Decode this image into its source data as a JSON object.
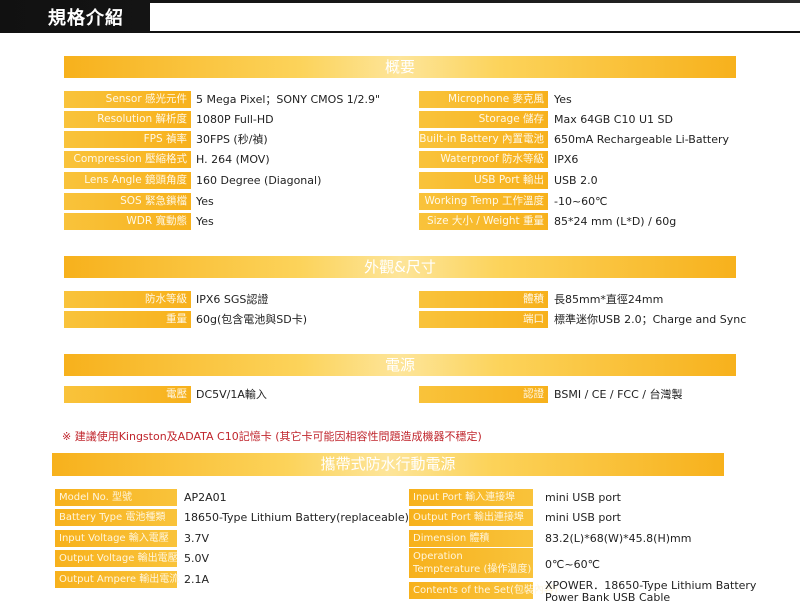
{
  "header": {
    "title": "規格介紹"
  },
  "sections": {
    "overview": "概要",
    "appearance": "外觀&尺寸",
    "power": "電源",
    "powerbank": "攜帶式防水行動電源"
  },
  "overview_left": [
    {
      "label": "Sensor 感光元件",
      "value": "5 Mega Pixel；SONY CMOS 1/2.9\""
    },
    {
      "label": "Resolution 解析度",
      "value": "1080P Full-HD"
    },
    {
      "label": "FPS  禎率",
      "value": "30FPS (秒/禎)"
    },
    {
      "label": "Compression  壓縮格式",
      "value": "H. 264 (MOV)"
    },
    {
      "label": "Lens Angle 鏡頭角度",
      "value": "160 Degree (Diagonal)"
    },
    {
      "label": "SOS 緊急鎖檔",
      "value": "Yes"
    },
    {
      "label": "WDR 寬動態",
      "value": "Yes"
    }
  ],
  "overview_right": [
    {
      "label": "Microphone 麥克風",
      "value": "Yes"
    },
    {
      "label": "Storage 儲存",
      "value": "Max 64GB C10 U1 SD"
    },
    {
      "label": "Built-in Battery 內置電池",
      "value": "650mA Rechargeable Li-Battery"
    },
    {
      "label": "Waterproof 防水等級",
      "value": "IPX6"
    },
    {
      "label": "USB Port 輸出",
      "value": "USB 2.0"
    },
    {
      "label": "Working Temp 工作溫度",
      "value": "-10~60℃"
    },
    {
      "label": "Size 大小 / Weight 重量",
      "value": "85*24 mm (L*D) /  60g"
    }
  ],
  "appearance_left": [
    {
      "label": "防水等級",
      "value": "IPX6 SGS認證"
    },
    {
      "label": "重量",
      "value": "60g(包含電池與SD卡)"
    }
  ],
  "appearance_right": [
    {
      "label": "體積",
      "value": "長85mm*直徑24mm"
    },
    {
      "label": "端口",
      "value": "標準迷你USB 2.0；Charge and Sync"
    }
  ],
  "power_left": {
    "label": "電壓",
    "value": "DC5V/1A輸入"
  },
  "power_right": {
    "label": "認證",
    "value": "BSMI / CE / FCC / 台灣製"
  },
  "note": "※ 建議使用Kingston及ADATA C10記憶卡 (其它卡可能因相容性問題造成機器不穩定)",
  "pb_left": [
    {
      "label": "Model No. 型號",
      "value": "AP2A01"
    },
    {
      "label": "Battery Type 電池種類",
      "value": "18650-Type Lithium Battery(replaceable)"
    },
    {
      "label": "Input Voltage 輸入電壓",
      "value": "3.7V"
    },
    {
      "label": "Output Voltage 輸出電壓",
      "value": "5.0V"
    },
    {
      "label": "Output Ampere 輸出電流",
      "value": "2.1A"
    }
  ],
  "pb_right": [
    {
      "label": "Input Port 輸入連接埠",
      "value": "mini USB port"
    },
    {
      "label": "Output Port 輸出連接埠",
      "value": "mini USB port"
    },
    {
      "label": "Dimension 體積",
      "value": "83.2(L)*68(W)*45.8(H)mm"
    },
    {
      "label": "Operation Tempterature (操作溫度)",
      "value": "0℃~60℃"
    },
    {
      "label": "Contents of the Set(包裝內容)",
      "value": "XPOWER．18650-Type Lithium Battery",
      "value2": "Power Bank USB Cable"
    }
  ]
}
